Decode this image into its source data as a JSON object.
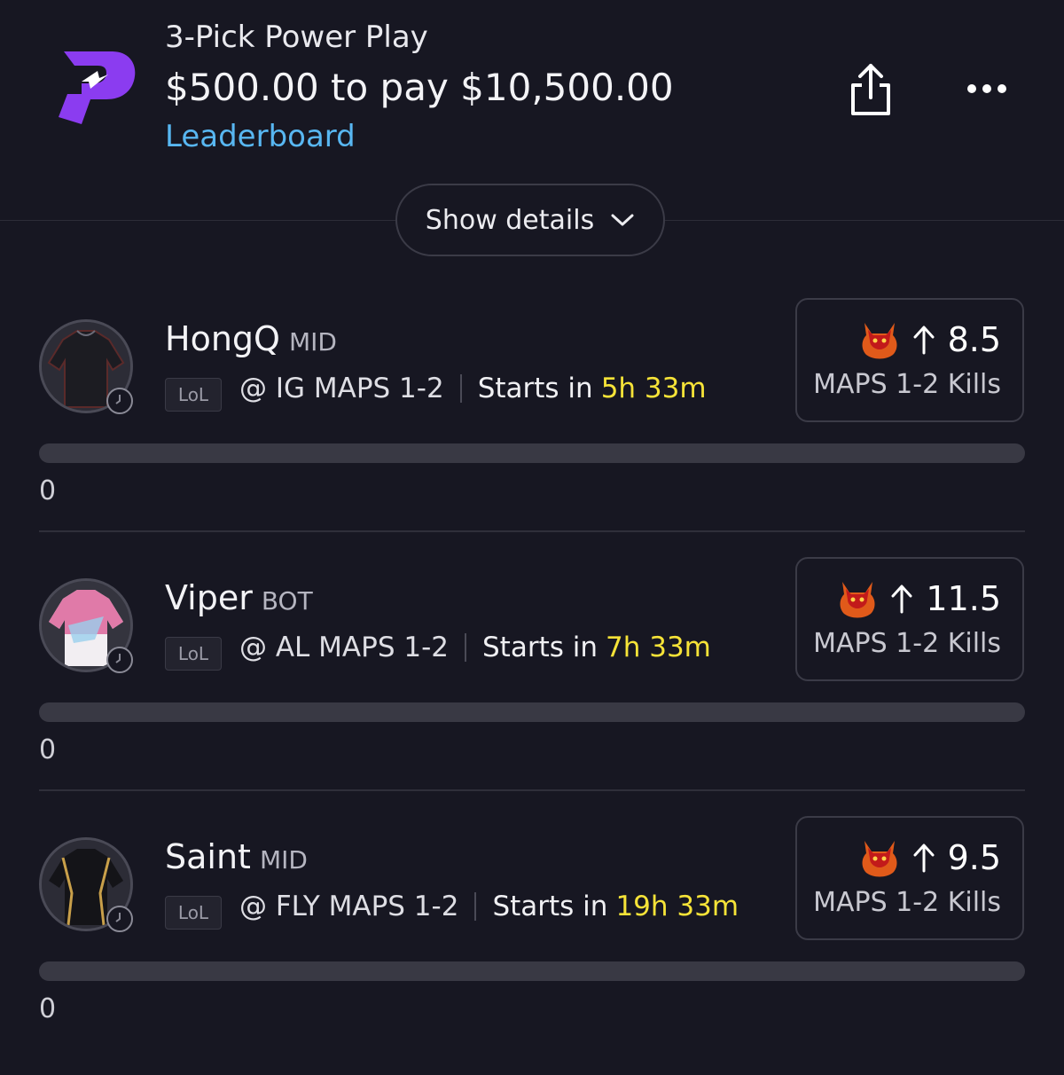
{
  "header": {
    "title": "3-Pick Power Play",
    "payout": "$500.00 to pay $10,500.00",
    "leaderboard_link": "Leaderboard",
    "show_details": "Show details",
    "share_icon": "share-icon",
    "more_icon": "more-horizontal-icon",
    "logo_icon": "prizepicks-logo"
  },
  "colors": {
    "background": "#171722",
    "accent_link": "#58b7f2",
    "time_highlight": "#f6e338",
    "logo_purple": "#8b3cf0"
  },
  "picks": [
    {
      "name": "HongQ",
      "position": "MID",
      "league": "LoL",
      "matchup": "@ IG MAPS 1-2",
      "starts_label": "Starts in",
      "starts_time": "5h 33m",
      "direction_icon": "arrow-up-icon",
      "demon_icon": "demon-icon",
      "line": "8.5",
      "stat": "MAPS 1-2 Kills",
      "progress": 0,
      "score": "0",
      "jersey": "black-jersey"
    },
    {
      "name": "Viper",
      "position": "BOT",
      "league": "LoL",
      "matchup": "@ AL MAPS 1-2",
      "starts_label": "Starts in",
      "starts_time": "7h 33m",
      "direction_icon": "arrow-up-icon",
      "demon_icon": "demon-icon",
      "line": "11.5",
      "stat": "MAPS 1-2 Kills",
      "progress": 0,
      "score": "0",
      "jersey": "pink-white-jersey"
    },
    {
      "name": "Saint",
      "position": "MID",
      "league": "LoL",
      "matchup": "@ FLY MAPS 1-2",
      "starts_label": "Starts in",
      "starts_time": "19h 33m",
      "direction_icon": "arrow-up-icon",
      "demon_icon": "demon-icon",
      "line": "9.5",
      "stat": "MAPS 1-2 Kills",
      "progress": 0,
      "score": "0",
      "jersey": "black-gold-jersey"
    }
  ]
}
